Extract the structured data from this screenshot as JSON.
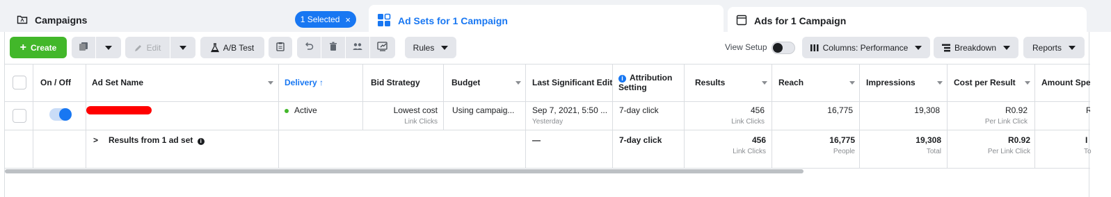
{
  "tabs": {
    "campaigns": {
      "label": "Campaigns",
      "selected_badge": "1 Selected",
      "close": "×"
    },
    "adsets": {
      "label": "Ad Sets for 1 Campaign"
    },
    "ads": {
      "label": "Ads for 1 Campaign"
    }
  },
  "toolbar": {
    "create_label": "Create",
    "edit_label": "Edit",
    "ab_test_label": "A/B Test",
    "rules_label": "Rules",
    "view_setup_label": "View Setup",
    "view_setup_on": false,
    "columns_label": "Columns: Performance",
    "breakdown_label": "Breakdown",
    "reports_label": "Reports"
  },
  "table": {
    "headers": {
      "on_off": "On / Off",
      "ad_set_name": "Ad Set Name",
      "delivery": "Delivery",
      "delivery_sort": "↑",
      "bid_strategy": "Bid Strategy",
      "budget": "Budget",
      "last_edit": "Last Significant Edit",
      "attribution_1": "Attribution",
      "attribution_2": "Setting",
      "results": "Results",
      "reach": "Reach",
      "impressions": "Impressions",
      "cost_per_result": "Cost per Result",
      "amount_spent": "Amount Spen"
    },
    "row": {
      "enabled": true,
      "delivery": "Active",
      "bid_strategy": "Lowest cost",
      "bid_strategy_sub": "Link Clicks",
      "budget": "Using campaig...",
      "last_edit": "Sep 7, 2021, 5:50 ...",
      "last_edit_sub": "Yesterday",
      "attribution": "7-day click",
      "results": "456",
      "results_sub": "Link Clicks",
      "reach": "16,775",
      "impressions": "19,308",
      "cost_per_result": "R0.92",
      "cost_per_result_sub": "Per Link Click",
      "amount_spent": "R"
    },
    "summary": {
      "expand": ">",
      "label": "Results from 1 ad set",
      "last_edit": "—",
      "attribution": "7-day click",
      "results": "456",
      "results_sub": "Link Clicks",
      "reach": "16,775",
      "reach_sub": "People",
      "impressions": "19,308",
      "impressions_sub": "Total",
      "cost_per_result": "R0.92",
      "cost_per_result_sub": "Per Link Click",
      "amount_spent": "I",
      "amount_spent_sub": "To"
    }
  },
  "colors": {
    "accent": "#1877f2",
    "create": "#42b72a",
    "redaction": "#ff0000"
  }
}
